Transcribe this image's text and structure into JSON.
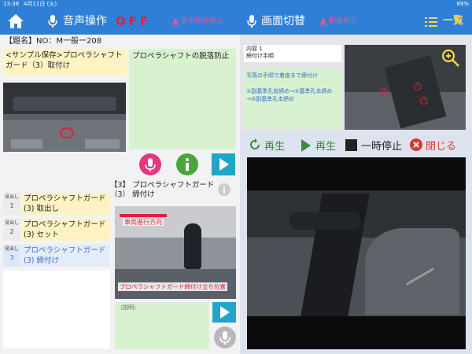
{
  "status": {
    "time": "13:38",
    "date": "4月11日 (火)",
    "battery": "89%"
  },
  "header": {
    "voice_label": "音声操作",
    "voice_state": "OFF",
    "voice_stop_label": "音声操作停止",
    "screen_switch_label": "画面切替",
    "video_stop_label": "動画停止",
    "list_label": "一覧"
  },
  "left": {
    "title": "【題名】NO：M一般ー208",
    "sample_text": "<サンプル保存>プロペラシャフトガード（3）取付け",
    "prevent_text": "プロペラシャフトの脱落防止",
    "section_heading": "【3】 プロペラシャフトガード\n（3） 締付け",
    "steps": [
      {
        "tag": "見出し",
        "num": "1",
        "text": "プロペラシャフトガード\n(3)  取出し",
        "active": false
      },
      {
        "tag": "見出し",
        "num": "2",
        "text": "プロペラシャフトガード\n(3)  セット",
        "active": false
      },
      {
        "tag": "見出し",
        "num": "3",
        "text": "プロペラシャフトガード\n(3)  締付け",
        "active": true
      }
    ],
    "photo_caption_top": "車両進行方向",
    "photo_caption_bottom": "プロペラシャフトガード締付け立ち位置",
    "description_label": "（説明）"
  },
  "right": {
    "content_label": "内容  1",
    "procedure_label": "締付け手順",
    "instruction_lines": "写真の手順で着座まで締付け\n\n①副基準孔仮締め→②基準孔本締め\n→③副基準孔本締め",
    "video_controls": {
      "replay": "再生",
      "play": "再生",
      "pause": "一時停止",
      "close": "閉じる"
    }
  },
  "colors": {
    "header_bg": "#2f7fd7",
    "red": "#e0203a",
    "accent": "#1fa6c9"
  }
}
